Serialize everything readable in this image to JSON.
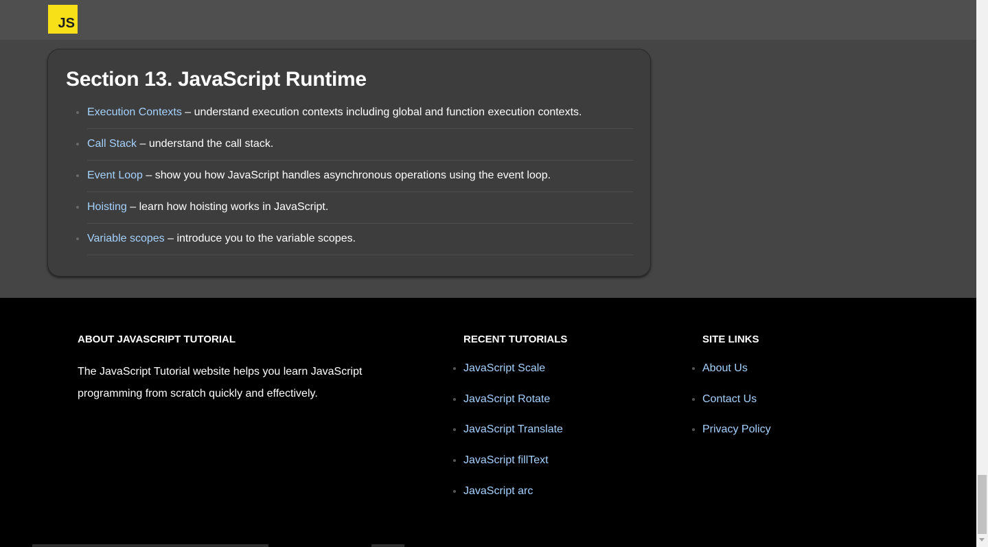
{
  "header": {
    "logo_text": "JS"
  },
  "section": {
    "title": "Section 13. JavaScript Runtime",
    "items": [
      {
        "link": "Execution Contexts",
        "text": " – understand execution contexts including global and function execution contexts."
      },
      {
        "link": "Call Stack",
        "text": " – understand the call stack."
      },
      {
        "link": "Event Loop",
        "text": " – show you how JavaScript handles asynchronous operations using the event loop."
      },
      {
        "link": "Hoisting",
        "text": " – learn how hoisting works in JavaScript."
      },
      {
        "link": "Variable scopes",
        "text": " – introduce you to the variable scopes."
      }
    ]
  },
  "footer": {
    "about": {
      "heading": "ABOUT JAVASCRIPT TUTORIAL",
      "text": "The JavaScript Tutorial website helps you learn JavaScript programming from scratch quickly and effectively."
    },
    "recent": {
      "heading": "RECENT TUTORIALS",
      "items": [
        "JavaScript Scale",
        "JavaScript Rotate",
        "JavaScript Translate",
        "JavaScript fillText",
        "JavaScript arc"
      ]
    },
    "site_links": {
      "heading": "SITE LINKS",
      "items": [
        "About Us",
        "Contact Us",
        "Privacy Policy"
      ]
    }
  },
  "colors": {
    "link": "#a5d2ff",
    "logo_bg": "#f7e018",
    "page_bg": "#454545",
    "card_bg": "#3d3d3d",
    "footer_bg": "#000000"
  }
}
